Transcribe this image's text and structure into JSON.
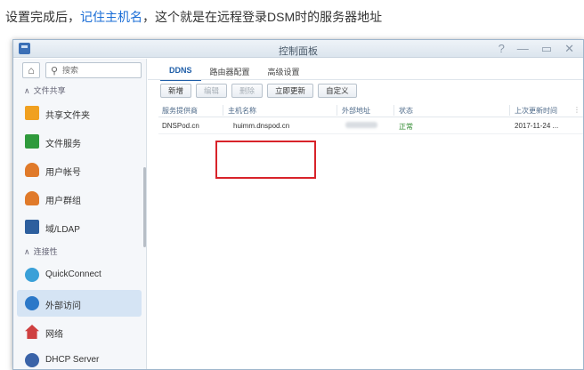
{
  "caption": {
    "prefix": "设置完成后，",
    "highlight": "记住主机名",
    "suffix": "，这个就是在远程登录DSM时的服务器地址"
  },
  "window": {
    "title": "控制面板",
    "controls": [
      "?",
      "—",
      "▭",
      "✕"
    ]
  },
  "sidebar": {
    "home_icon": "⌂",
    "search_placeholder": "搜索",
    "section1": "文件共享",
    "items1": [
      {
        "label": "共享文件夹",
        "icon": "folder-icon",
        "color": "#f0a020"
      },
      {
        "label": "文件服务",
        "icon": "file-service-icon",
        "color": "#2f9a3c"
      },
      {
        "label": "用户帐号",
        "icon": "user-icon",
        "color": "#e07a2a"
      },
      {
        "label": "用户群组",
        "icon": "group-icon",
        "color": "#e07a2a"
      },
      {
        "label": "域/LDAP",
        "icon": "ldap-icon",
        "color": "#2d5f9e"
      }
    ],
    "section2": "连接性",
    "items2": [
      {
        "label": "QuickConnect",
        "icon": "quickconnect-icon",
        "color": "#3aa0d8"
      },
      {
        "label": "外部访问",
        "icon": "external-access-icon",
        "color": "#2b78c8"
      },
      {
        "label": "网络",
        "icon": "network-icon",
        "color": "#cf4040"
      },
      {
        "label": "DHCP Server",
        "icon": "dhcp-icon",
        "color": "#3a63a8"
      }
    ]
  },
  "main": {
    "tabs": [
      "DDNS",
      "路由器配置",
      "高级设置"
    ],
    "toolbar": {
      "add": "新增",
      "edit": "编辑",
      "delete": "删除",
      "update_now": "立即更新",
      "customize": "自定义"
    },
    "columns": {
      "provider": "服务提供商",
      "hostname": "主机名称",
      "external_ip": "外部地址",
      "status": "状态",
      "last_update": "上次更新时间"
    },
    "rows": [
      {
        "provider": "DNSPod.cn",
        "hostname": "huimm.dnspod.cn",
        "status": "正常",
        "last_update": "2017-11-24 ..."
      }
    ]
  },
  "colors": {
    "accent": "#1f5ea8",
    "highlight_box": "#d8232a",
    "caption_highlight": "#1a6dd6",
    "status_ok": "#2f8a2f"
  }
}
